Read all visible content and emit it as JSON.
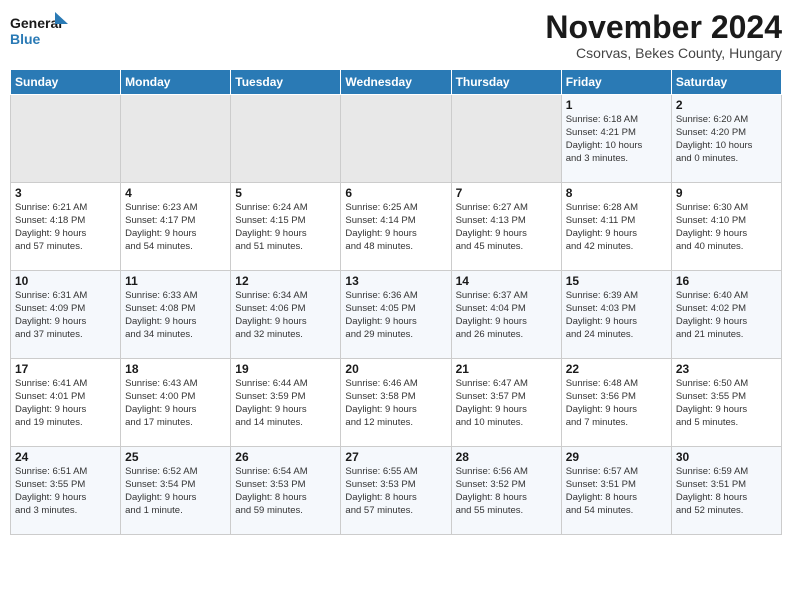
{
  "header": {
    "logo_line1": "General",
    "logo_line2": "Blue",
    "month_year": "November 2024",
    "location": "Csorvas, Bekes County, Hungary"
  },
  "weekdays": [
    "Sunday",
    "Monday",
    "Tuesday",
    "Wednesday",
    "Thursday",
    "Friday",
    "Saturday"
  ],
  "weeks": [
    [
      {
        "day": "",
        "content": ""
      },
      {
        "day": "",
        "content": ""
      },
      {
        "day": "",
        "content": ""
      },
      {
        "day": "",
        "content": ""
      },
      {
        "day": "",
        "content": ""
      },
      {
        "day": "1",
        "content": "Sunrise: 6:18 AM\nSunset: 4:21 PM\nDaylight: 10 hours\nand 3 minutes."
      },
      {
        "day": "2",
        "content": "Sunrise: 6:20 AM\nSunset: 4:20 PM\nDaylight: 10 hours\nand 0 minutes."
      }
    ],
    [
      {
        "day": "3",
        "content": "Sunrise: 6:21 AM\nSunset: 4:18 PM\nDaylight: 9 hours\nand 57 minutes."
      },
      {
        "day": "4",
        "content": "Sunrise: 6:23 AM\nSunset: 4:17 PM\nDaylight: 9 hours\nand 54 minutes."
      },
      {
        "day": "5",
        "content": "Sunrise: 6:24 AM\nSunset: 4:15 PM\nDaylight: 9 hours\nand 51 minutes."
      },
      {
        "day": "6",
        "content": "Sunrise: 6:25 AM\nSunset: 4:14 PM\nDaylight: 9 hours\nand 48 minutes."
      },
      {
        "day": "7",
        "content": "Sunrise: 6:27 AM\nSunset: 4:13 PM\nDaylight: 9 hours\nand 45 minutes."
      },
      {
        "day": "8",
        "content": "Sunrise: 6:28 AM\nSunset: 4:11 PM\nDaylight: 9 hours\nand 42 minutes."
      },
      {
        "day": "9",
        "content": "Sunrise: 6:30 AM\nSunset: 4:10 PM\nDaylight: 9 hours\nand 40 minutes."
      }
    ],
    [
      {
        "day": "10",
        "content": "Sunrise: 6:31 AM\nSunset: 4:09 PM\nDaylight: 9 hours\nand 37 minutes."
      },
      {
        "day": "11",
        "content": "Sunrise: 6:33 AM\nSunset: 4:08 PM\nDaylight: 9 hours\nand 34 minutes."
      },
      {
        "day": "12",
        "content": "Sunrise: 6:34 AM\nSunset: 4:06 PM\nDaylight: 9 hours\nand 32 minutes."
      },
      {
        "day": "13",
        "content": "Sunrise: 6:36 AM\nSunset: 4:05 PM\nDaylight: 9 hours\nand 29 minutes."
      },
      {
        "day": "14",
        "content": "Sunrise: 6:37 AM\nSunset: 4:04 PM\nDaylight: 9 hours\nand 26 minutes."
      },
      {
        "day": "15",
        "content": "Sunrise: 6:39 AM\nSunset: 4:03 PM\nDaylight: 9 hours\nand 24 minutes."
      },
      {
        "day": "16",
        "content": "Sunrise: 6:40 AM\nSunset: 4:02 PM\nDaylight: 9 hours\nand 21 minutes."
      }
    ],
    [
      {
        "day": "17",
        "content": "Sunrise: 6:41 AM\nSunset: 4:01 PM\nDaylight: 9 hours\nand 19 minutes."
      },
      {
        "day": "18",
        "content": "Sunrise: 6:43 AM\nSunset: 4:00 PM\nDaylight: 9 hours\nand 17 minutes."
      },
      {
        "day": "19",
        "content": "Sunrise: 6:44 AM\nSunset: 3:59 PM\nDaylight: 9 hours\nand 14 minutes."
      },
      {
        "day": "20",
        "content": "Sunrise: 6:46 AM\nSunset: 3:58 PM\nDaylight: 9 hours\nand 12 minutes."
      },
      {
        "day": "21",
        "content": "Sunrise: 6:47 AM\nSunset: 3:57 PM\nDaylight: 9 hours\nand 10 minutes."
      },
      {
        "day": "22",
        "content": "Sunrise: 6:48 AM\nSunset: 3:56 PM\nDaylight: 9 hours\nand 7 minutes."
      },
      {
        "day": "23",
        "content": "Sunrise: 6:50 AM\nSunset: 3:55 PM\nDaylight: 9 hours\nand 5 minutes."
      }
    ],
    [
      {
        "day": "24",
        "content": "Sunrise: 6:51 AM\nSunset: 3:55 PM\nDaylight: 9 hours\nand 3 minutes."
      },
      {
        "day": "25",
        "content": "Sunrise: 6:52 AM\nSunset: 3:54 PM\nDaylight: 9 hours\nand 1 minute."
      },
      {
        "day": "26",
        "content": "Sunrise: 6:54 AM\nSunset: 3:53 PM\nDaylight: 8 hours\nand 59 minutes."
      },
      {
        "day": "27",
        "content": "Sunrise: 6:55 AM\nSunset: 3:53 PM\nDaylight: 8 hours\nand 57 minutes."
      },
      {
        "day": "28",
        "content": "Sunrise: 6:56 AM\nSunset: 3:52 PM\nDaylight: 8 hours\nand 55 minutes."
      },
      {
        "day": "29",
        "content": "Sunrise: 6:57 AM\nSunset: 3:51 PM\nDaylight: 8 hours\nand 54 minutes."
      },
      {
        "day": "30",
        "content": "Sunrise: 6:59 AM\nSunset: 3:51 PM\nDaylight: 8 hours\nand 52 minutes."
      }
    ]
  ]
}
